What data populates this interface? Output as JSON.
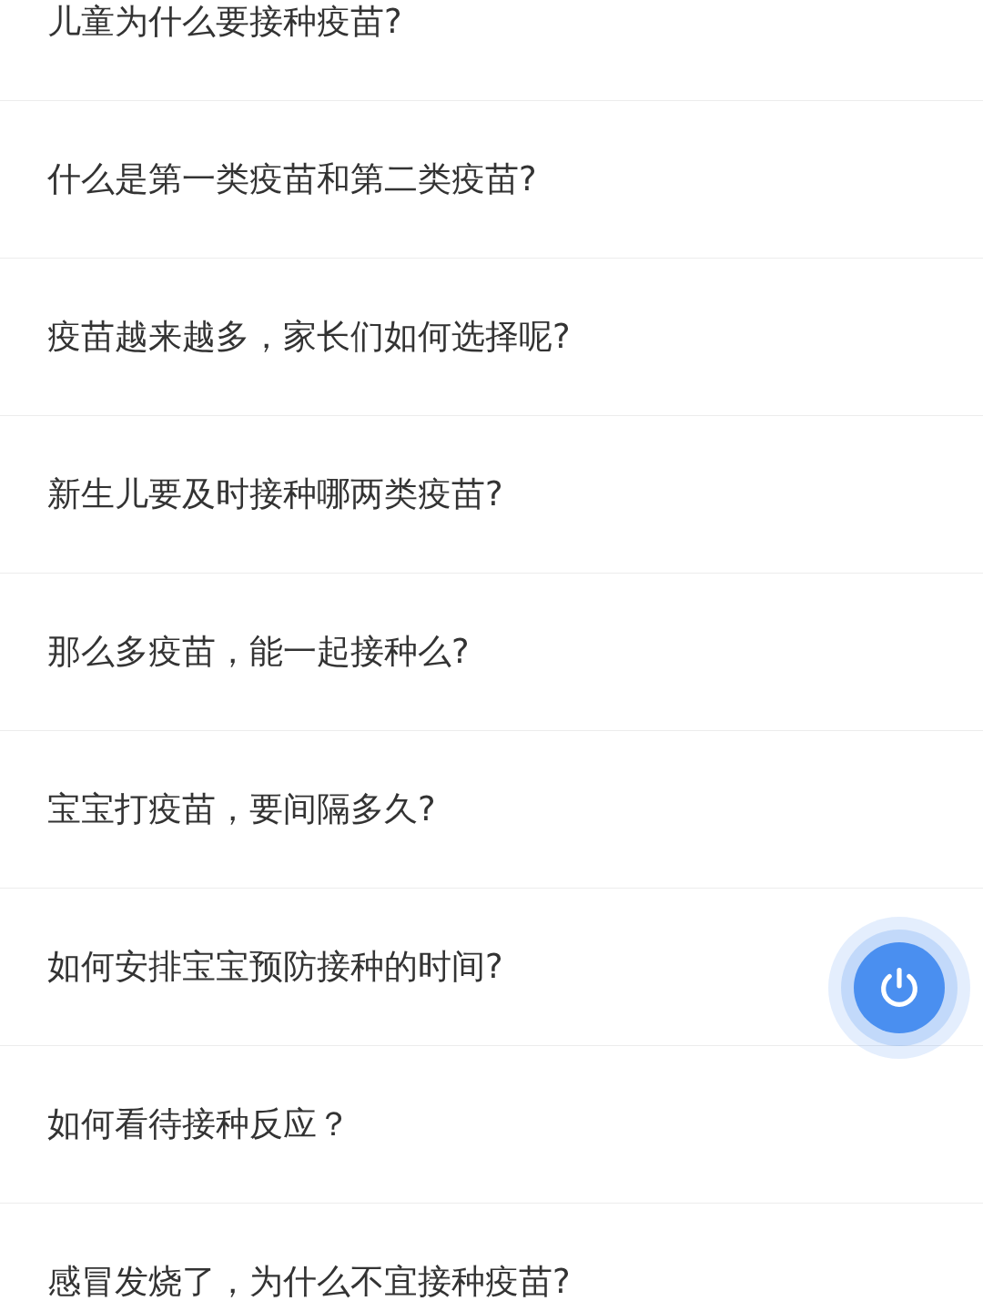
{
  "questions": [
    {
      "text": "儿童为什么要接种疫苗?"
    },
    {
      "text": "什么是第一类疫苗和第二类疫苗?"
    },
    {
      "text": "疫苗越来越多，家长们如何选择呢?"
    },
    {
      "text": "新生儿要及时接种哪两类疫苗?"
    },
    {
      "text": "那么多疫苗，能一起接种么?"
    },
    {
      "text": "宝宝打疫苗，要间隔多久?"
    },
    {
      "text": "如何安排宝宝预防接种的时间?"
    },
    {
      "text": "如何看待接种反应？"
    },
    {
      "text": "感冒发烧了，为什么不宜接种疫苗?"
    }
  ]
}
